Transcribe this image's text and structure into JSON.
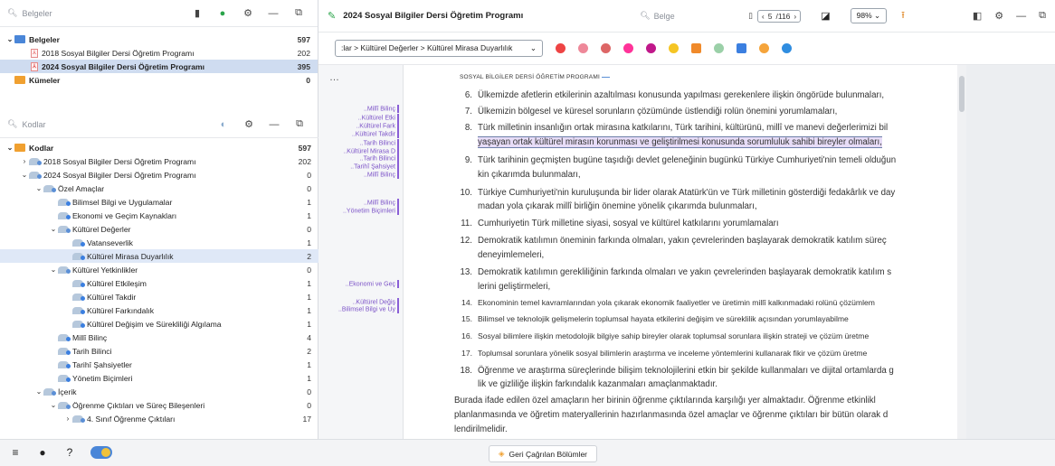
{
  "doc_pane": {
    "search_placeholder": "Belgeler",
    "tree": [
      {
        "label": "Belgeler",
        "count": "597",
        "level": 0,
        "bold": true,
        "icon": "folder-icon"
      },
      {
        "label": "2018 Sosyal Bilgiler Dersi Öğretim Programı",
        "count": "202",
        "level": 1,
        "icon": "pdf-icon"
      },
      {
        "label": "2024 Sosyal Bilgiler Dersi Öğretim Programı",
        "count": "395",
        "level": 1,
        "bold": true,
        "icon": "pdf-icon",
        "selected": true
      },
      {
        "label": "Kümeler",
        "count": "0",
        "level": 0,
        "bold": true,
        "icon": "folder-icon"
      }
    ]
  },
  "code_pane": {
    "search_placeholder": "Kodlar",
    "tree": [
      {
        "label": "Kodlar",
        "count": "597",
        "level": 0,
        "bold": true,
        "caret": "v"
      },
      {
        "label": "2018 Sosyal Bilgiler Dersi Öğretim Programı",
        "count": "202",
        "level": 1,
        "caret": ">"
      },
      {
        "label": "2024 Sosyal Bilgiler Dersi Öğretim Programı",
        "count": "0",
        "level": 1,
        "caret": "v"
      },
      {
        "label": "Özel Amaçlar",
        "count": "0",
        "level": 2,
        "caret": "v"
      },
      {
        "label": "Bilimsel Bilgi ve Uygulamalar",
        "count": "1",
        "level": 3
      },
      {
        "label": "Ekonomi ve Geçim Kaynakları",
        "count": "1",
        "level": 3
      },
      {
        "label": "Kültürel Değerler",
        "count": "0",
        "level": 3,
        "caret": "v"
      },
      {
        "label": "Vatanseverlik",
        "count": "1",
        "level": 4
      },
      {
        "label": "Kültürel Mirasa Duyarlılık",
        "count": "2",
        "level": 4,
        "selected": true
      },
      {
        "label": "Kültürel Yetkinlikler",
        "count": "0",
        "level": 3,
        "caret": "v"
      },
      {
        "label": "Kültürel Etkileşim",
        "count": "1",
        "level": 4
      },
      {
        "label": "Kültürel Takdir",
        "count": "1",
        "level": 4
      },
      {
        "label": "Kültürel Farkındalık",
        "count": "1",
        "level": 4
      },
      {
        "label": "Kültürel Değişim ve Sürekliliği Algılama",
        "count": "1",
        "level": 4
      },
      {
        "label": "Millî Bilinç",
        "count": "4",
        "level": 3
      },
      {
        "label": "Tarih Bilinci",
        "count": "2",
        "level": 3
      },
      {
        "label": "Tarihî Şahsiyetler",
        "count": "1",
        "level": 3
      },
      {
        "label": "Yönetim Biçimleri",
        "count": "1",
        "level": 3
      },
      {
        "label": "İçerik",
        "count": "0",
        "level": 2,
        "caret": "v"
      },
      {
        "label": "Öğrenme Çıktıları ve Süreç Bileşenleri",
        "count": "0",
        "level": 3,
        "caret": "v"
      },
      {
        "label": "4. Sınıf Öğrenme Çıktıları",
        "count": "17",
        "level": 4,
        "caret": ">"
      }
    ]
  },
  "doc_view": {
    "title": "2024 Sosyal Bilgiler Dersi Öğretim Programı",
    "search_placeholder": "Belge",
    "page_current": "5",
    "page_total": "/116",
    "zoom": "98%",
    "breadcrumb": ":lar > Kültürel Değerler > Kültürel Mirasa Duyarlılık",
    "page_header": "SOSYAL BİLGİLER DERSİ ÖĞRETİM PROGRAMI",
    "lines": [
      {
        "num": "6.",
        "text": "Ülkemizde afetlerin etkilerinin azaltılması konusunda yapılması gerekenlere ilişkin öngörüde bulunmaları,"
      },
      {
        "num": "7.",
        "text": "Ülkemizin bölgesel ve küresel sorunların çözümünde üstlendiği rolün önemini yorumlamaları,"
      },
      {
        "num": "8.",
        "text": "Türk milletinin insanlığın ortak mirasına katkılarını, Türk tarihini, kültürünü, millî ve manevi değerlerimizi bil"
      },
      {
        "num": "",
        "text": "yaşayan ortak kültürel mirasın korunması ve geliştirilmesi konusunda sorumluluk sahibi bireyler olmaları,",
        "highlight": true
      },
      {
        "num": "9.",
        "text": "Türk tarihinin geçmişten bugüne taşıdığı devlet geleneğinin bugünkü Türkiye Cumhuriyeti'nin temeli olduğun"
      },
      {
        "num": "",
        "text": "kin çıkarımda bulunmaları,"
      },
      {
        "num": "10.",
        "text": "Türkiye Cumhuriyeti'nin kuruluşunda bir lider olarak Atatürk'ün ve Türk milletinin gösterdiği fedakârlık ve day"
      },
      {
        "num": "",
        "text": "madan yola çıkarak millî birliğin önemine yönelik çıkarımda bulunmaları,"
      },
      {
        "num": "11.",
        "text": "Cumhuriyetin Türk milletine siyasi, sosyal ve kültürel katkılarını yorumlamaları"
      },
      {
        "num": "12.",
        "text": "Demokratik katılımın öneminin farkında olmaları, yakın çevrelerinden başlayarak demokratik katılım süreç"
      },
      {
        "num": "",
        "text": "deneyimlemeleri,"
      },
      {
        "num": "13.",
        "text": "Demokratik katılımın gerekliliğinin farkında olmaları ve yakın çevrelerinden başlayarak demokratik katılım s"
      },
      {
        "num": "",
        "text": "lerini geliştirmeleri,"
      },
      {
        "num": "14.",
        "text": "Ekonominin temel kavramlarından yola çıkarak ekonomik faaliyetler ve üretimin millî kalkınmadaki rolünü çözümlem",
        "small": true
      },
      {
        "num": "15.",
        "text": "Bilimsel ve teknolojik gelişmelerin toplumsal hayata etkilerini değişim ve süreklilik açısından yorumlayabilme",
        "small": true
      },
      {
        "num": "16.",
        "text": "Sosyal bilimlere ilişkin metodolojik bilgiye sahip bireyler olarak toplumsal sorunlara ilişkin strateji ve çözüm üretme",
        "small": true
      },
      {
        "num": "17.",
        "text": "Toplumsal sorunlara yönelik sosyal bilimlerin araştırma ve inceleme yöntemlerini kullanarak fikir ve çözüm üretme",
        "small": true
      },
      {
        "num": "18.",
        "text": "Öğrenme ve araştırma süreçlerinde bilişim teknolojilerini etkin bir şekilde kullanmaları ve dijital ortamlarda g"
      },
      {
        "num": "",
        "text": "lik ve gizliliğe ilişkin farkındalık kazanmaları amaçlanmaktadır."
      },
      {
        "num": "",
        "text": "Burada ifade edilen özel amaçların her birinin öğrenme çıktılarında karşılığı yer almaktadır. Öğrenme etkinlikl",
        "para": true
      },
      {
        "num": "",
        "text": "planlanmasında ve öğretim materyallerinin hazırlanmasında özel amaçlar ve öğrenme çıktıları bir bütün olarak d",
        "para": true
      },
      {
        "num": "",
        "text": "lendirilmelidir.",
        "para": true
      }
    ]
  },
  "code_marks": [
    {
      "label": "Millî Bilinç"
    },
    {
      "label": "Kültürel Etki"
    },
    {
      "label": "Kültürel Fark"
    },
    {
      "label": "Kültürel Takdir"
    },
    {
      "label": "Tarih Bilinci"
    },
    {
      "label": "Kültürel Mirasa D"
    },
    {
      "label": "Tarih Bilinci"
    },
    {
      "label": "Tarihî Şahsiyet"
    },
    {
      "label": "Millî Bilinç"
    },
    {
      "label": "Millî Bilinç"
    },
    {
      "label": "Yönetim Biçimleri"
    },
    {
      "label": "Ekonomi ve Geç"
    },
    {
      "label": "Kültürel Değiş"
    },
    {
      "label": "Bilimsel Bilgi ve Uy"
    }
  ],
  "status_bar": {
    "retrieved_button": "Geri Çağrılan Bölümler"
  }
}
